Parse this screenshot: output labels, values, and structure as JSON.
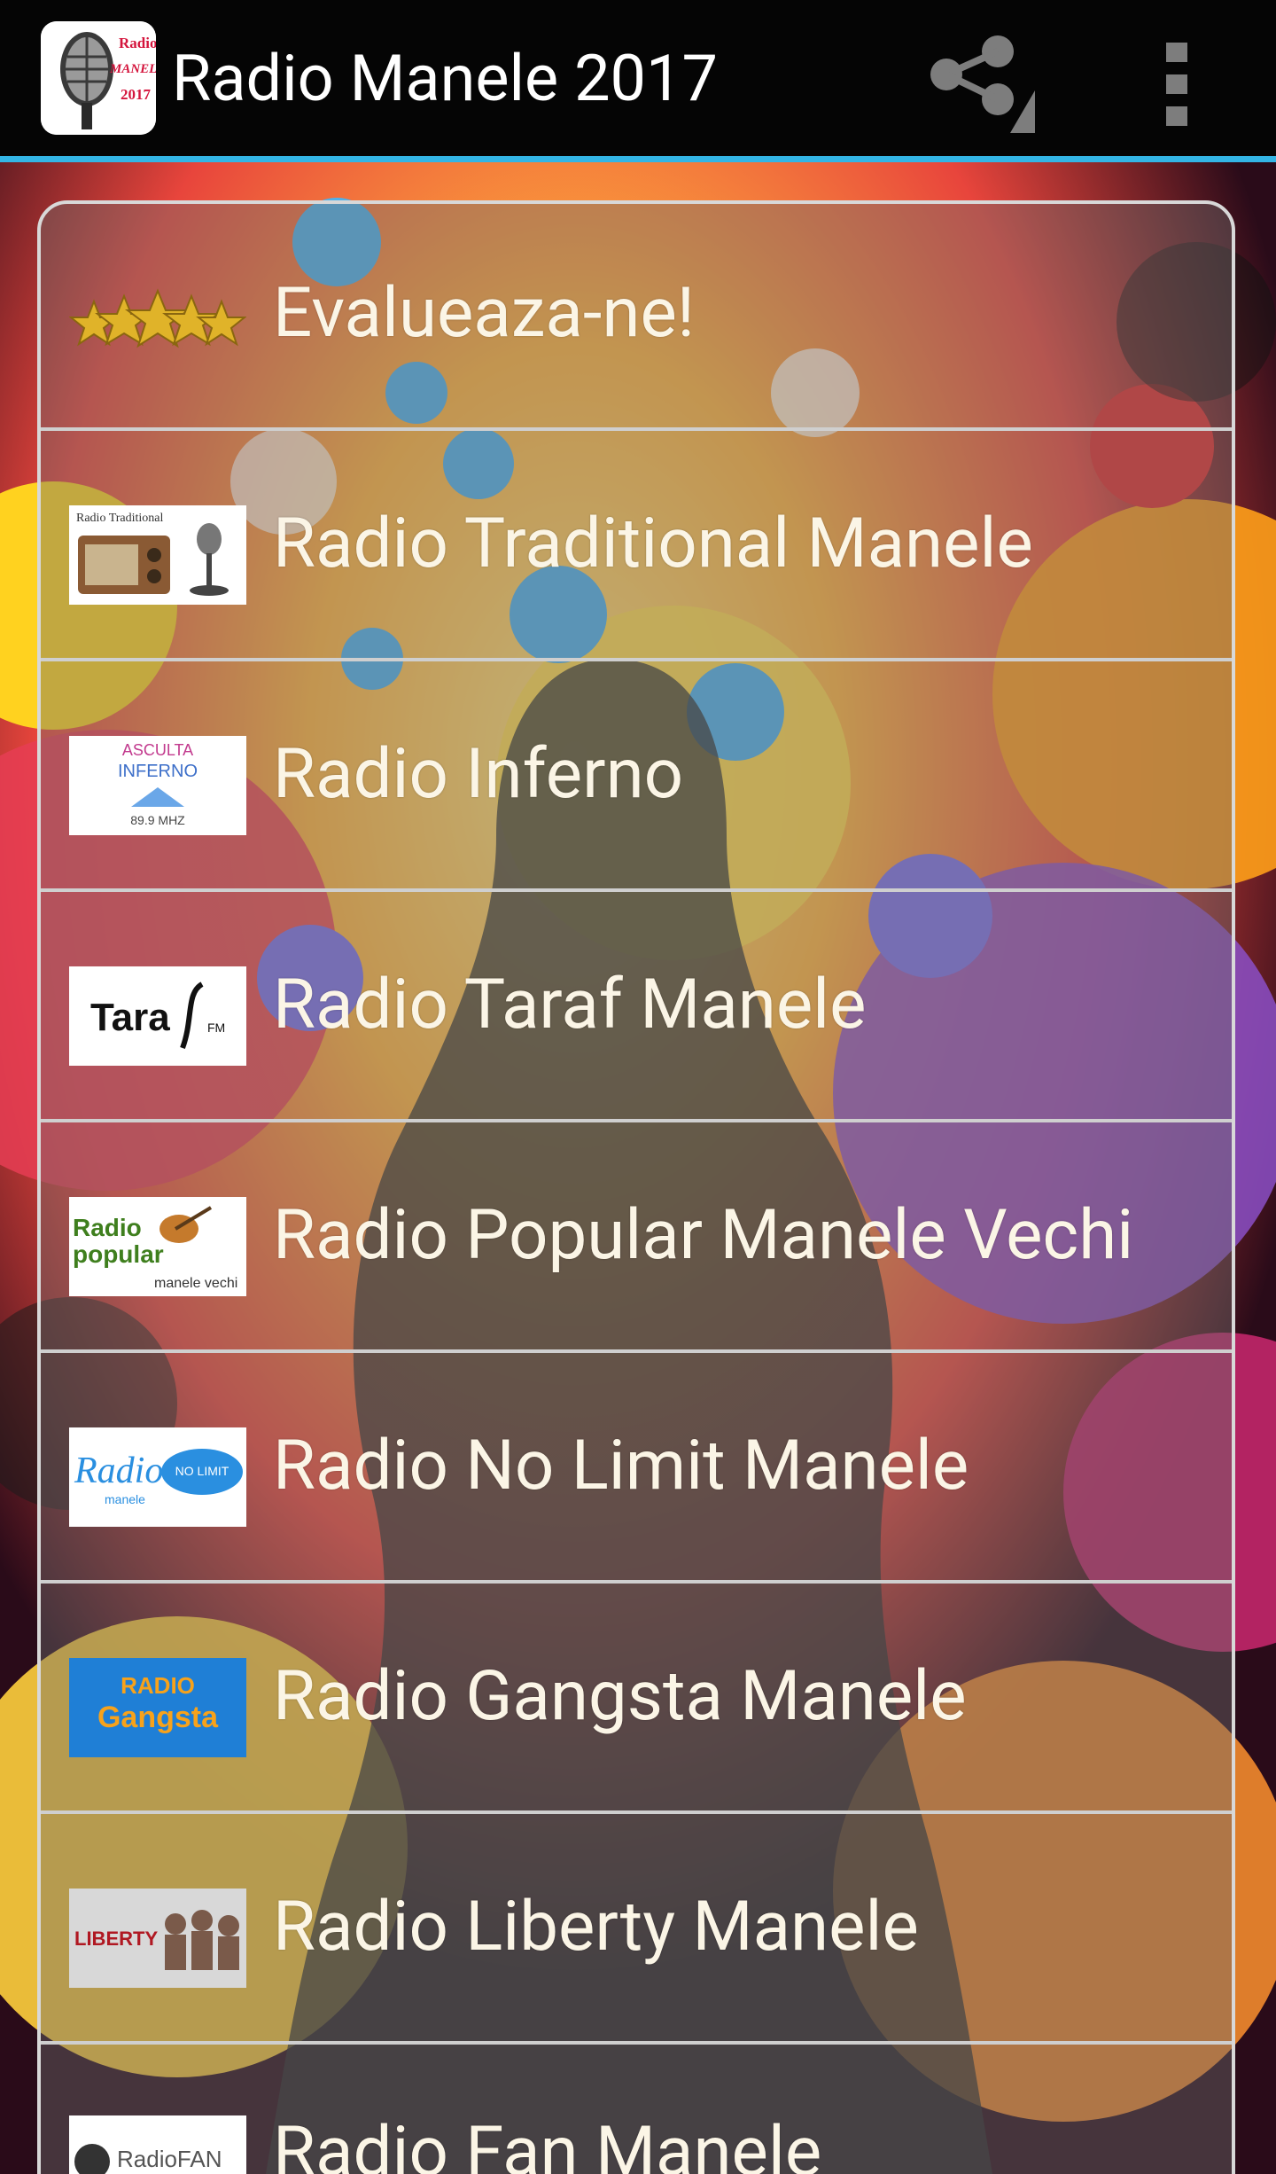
{
  "app_bar": {
    "title": "Radio Manele 2017",
    "icon": "microphone-app-icon",
    "icon_text_line1": "Radio",
    "icon_text_line2": "MANELE",
    "icon_text_line3": "2017",
    "actions": [
      "share-icon",
      "overflow-menu-icon"
    ],
    "accent_color": "#33b5e5"
  },
  "list": {
    "items": [
      {
        "label": "Evalueaza-ne!",
        "icon": "five-stars-icon"
      },
      {
        "label": "Radio Traditional Manele",
        "icon": "radio-traditional-logo",
        "logo_text": "Radio Traditional"
      },
      {
        "label": "Radio Inferno",
        "icon": "radio-inferno-logo",
        "logo_text_1": "ASCULTA",
        "logo_text_2": "INFERNO",
        "logo_text_3": "89.9 MHZ"
      },
      {
        "label": "Radio Taraf Manele",
        "icon": "taraf-fm-logo",
        "logo_text_1": "Tara",
        "logo_text_2": "FM"
      },
      {
        "label": "Radio Popular Manele Vechi",
        "icon": "radio-popular-logo",
        "logo_text_1": "Radio",
        "logo_text_2": "popular",
        "logo_text_3": "manele vechi"
      },
      {
        "label": "Radio No Limit Manele",
        "icon": "radio-no-limit-logo",
        "logo_text_1": "Radio",
        "logo_text_2": "NO LIMIT",
        "logo_text_3": "manele"
      },
      {
        "label": "Radio Gangsta Manele",
        "icon": "radio-gangsta-logo",
        "logo_text_1": "RADIO",
        "logo_text_2": "Gangsta"
      },
      {
        "label": "Radio Liberty Manele",
        "icon": "radio-liberty-logo",
        "logo_text_1": "LIBERTY"
      },
      {
        "label": "Radio Fan Manele",
        "icon": "radio-fan-logo",
        "logo_text_1": "RadioFAN"
      }
    ]
  }
}
